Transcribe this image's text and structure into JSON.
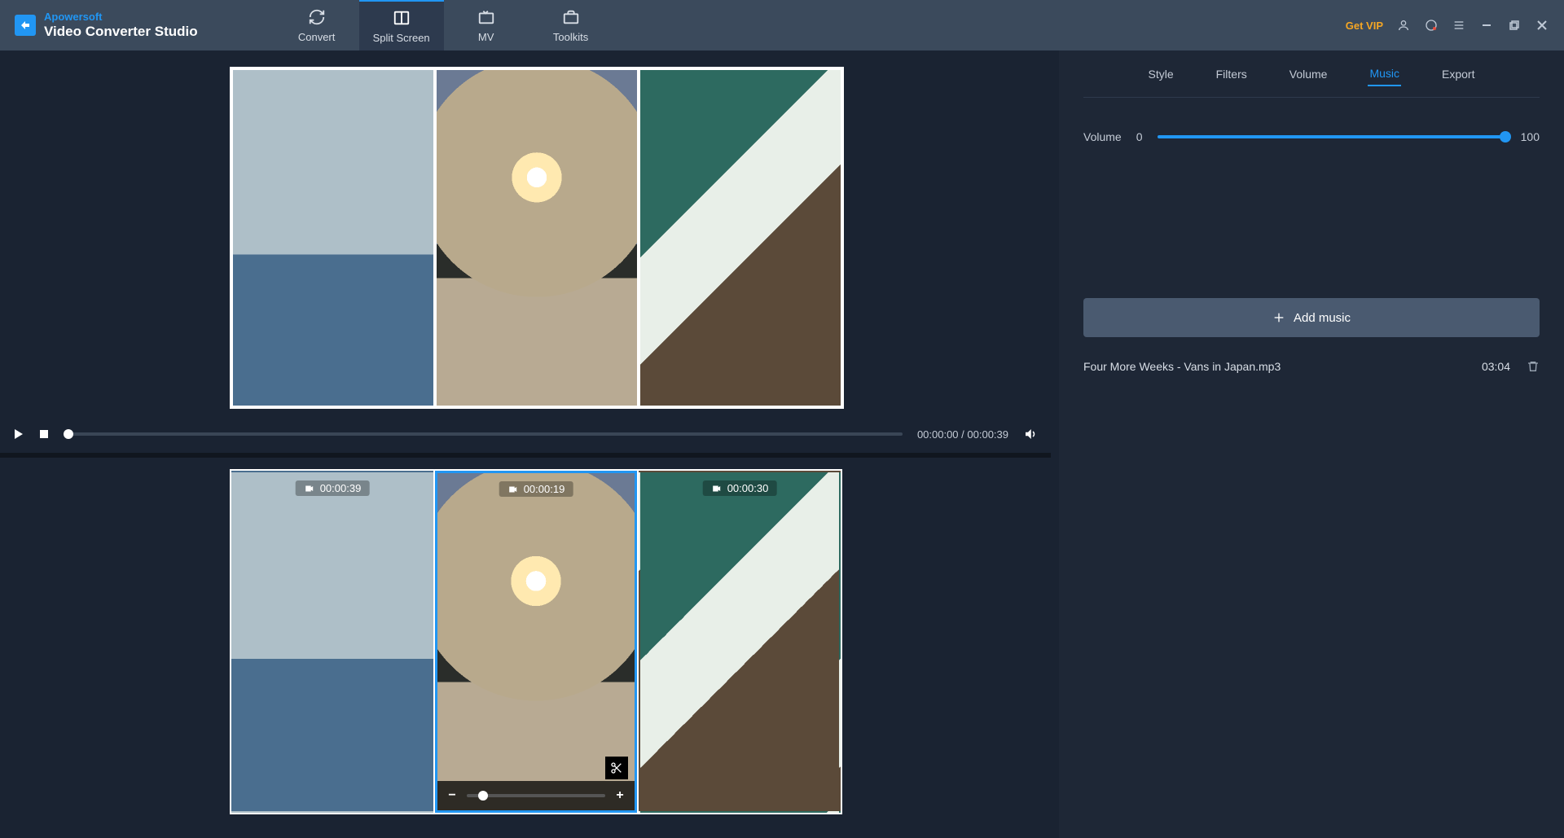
{
  "brand": {
    "top": "Apowersoft",
    "bottom": "Video Converter Studio"
  },
  "main_tabs": {
    "convert": "Convert",
    "split_screen": "Split Screen",
    "mv": "MV",
    "toolkits": "Toolkits"
  },
  "titlebar": {
    "get_vip": "Get VIP"
  },
  "playbar": {
    "current_time": "00:00:00",
    "total_time": "00:00:39"
  },
  "clips": [
    {
      "duration": "00:00:39"
    },
    {
      "duration": "00:00:19"
    },
    {
      "duration": "00:00:30"
    }
  ],
  "side_tabs": {
    "style": "Style",
    "filters": "Filters",
    "volume": "Volume",
    "music": "Music",
    "export": "Export"
  },
  "volume_panel": {
    "label": "Volume",
    "min": "0",
    "max": "100"
  },
  "add_music_label": "Add music",
  "tracks": [
    {
      "name": "Four More Weeks - Vans in Japan.mp3",
      "duration": "03:04"
    }
  ]
}
